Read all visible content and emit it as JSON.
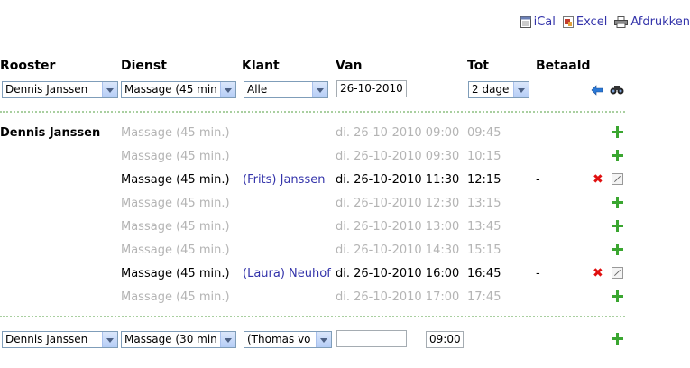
{
  "exports": [
    {
      "label": "iCal",
      "icon": "calendar-icon"
    },
    {
      "label": "Excel",
      "icon": "excel-icon"
    },
    {
      "label": "Afdrukken",
      "icon": "printer-icon"
    }
  ],
  "headers": {
    "rooster": "Rooster",
    "dienst": "Dienst",
    "klant": "Klant",
    "van": "Van",
    "tot": "Tot",
    "betaald": "Betaald"
  },
  "filters": {
    "rooster": "Dennis Janssen",
    "dienst": "Massage (45 min",
    "klant": "Alle",
    "van": "26-10-2010",
    "tot": "2 dage"
  },
  "employee": "Dennis Janssen",
  "rows": [
    {
      "dienst": "Massage (45 min.)",
      "klant": "",
      "van": "di. 26-10-2010 09:00",
      "tot": "09:45",
      "betaald": "",
      "booked": false
    },
    {
      "dienst": "Massage (45 min.)",
      "klant": "",
      "van": "di. 26-10-2010 09:30",
      "tot": "10:15",
      "betaald": "",
      "booked": false
    },
    {
      "dienst": "Massage (45 min.)",
      "klant": "(Frits) Janssen",
      "van": "di. 26-10-2010 11:30",
      "tot": "12:15",
      "betaald": "-",
      "booked": true
    },
    {
      "dienst": "Massage (45 min.)",
      "klant": "",
      "van": "di. 26-10-2010 12:30",
      "tot": "13:15",
      "betaald": "",
      "booked": false
    },
    {
      "dienst": "Massage (45 min.)",
      "klant": "",
      "van": "di. 26-10-2010 13:00",
      "tot": "13:45",
      "betaald": "",
      "booked": false
    },
    {
      "dienst": "Massage (45 min.)",
      "klant": "",
      "van": "di. 26-10-2010 14:30",
      "tot": "15:15",
      "betaald": "",
      "booked": false
    },
    {
      "dienst": "Massage (45 min.)",
      "klant": "(Laura) Neuhof",
      "van": "di. 26-10-2010 16:00",
      "tot": "16:45",
      "betaald": "-",
      "booked": true
    },
    {
      "dienst": "Massage (45 min.)",
      "klant": "",
      "van": "di. 26-10-2010 17:00",
      "tot": "17:45",
      "betaald": "",
      "booked": false
    }
  ],
  "new_entry": {
    "rooster": "Dennis Janssen",
    "dienst": "Massage (30 min",
    "klant": "(Thomas vo",
    "van": "",
    "tot": "09:00"
  }
}
